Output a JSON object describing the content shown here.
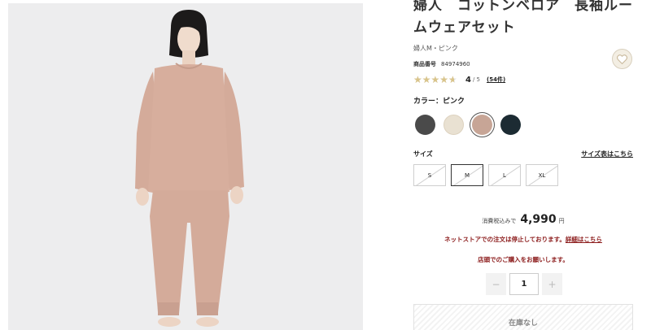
{
  "product": {
    "title": "婦人　コットンベロア　長袖ルームウェアセット",
    "subtitle": "婦人M・ピンク",
    "sku_label": "商品番号",
    "sku_value": "84974960"
  },
  "rating": {
    "stars_glyphs": "★★★★★",
    "score": "4",
    "of": "/ 5",
    "count": "(54件)",
    "value": 4,
    "max": 5,
    "star_color": "#d9c48a"
  },
  "favorite": {
    "icon": "heart-icon"
  },
  "color": {
    "label": "カラー：ピンク",
    "swatches": [
      {
        "name": "charcoal",
        "hex": "#4a4a4a"
      },
      {
        "name": "beige",
        "hex": "#e9e1d2"
      },
      {
        "name": "pink",
        "hex": "#c7a596",
        "selected": true
      },
      {
        "name": "navy",
        "hex": "#1c2b33"
      }
    ]
  },
  "size": {
    "label": "サイズ",
    "guide_link": "サイズ表はこちら",
    "options": [
      "S",
      "M",
      "L",
      "XL"
    ],
    "selected": "M"
  },
  "price": {
    "prefix": "消費税込みで",
    "amount": "4,990",
    "currency": "円"
  },
  "notice": {
    "line1": "ネットストアでの注文は停止しております。",
    "link": "詳細はこちら",
    "line2": "店頭でのご購入をお願いします。",
    "color": "#8b1a1a"
  },
  "quantity": {
    "minus": "−",
    "value": "1",
    "plus": "+"
  },
  "cart": {
    "label": "在庫なし"
  }
}
